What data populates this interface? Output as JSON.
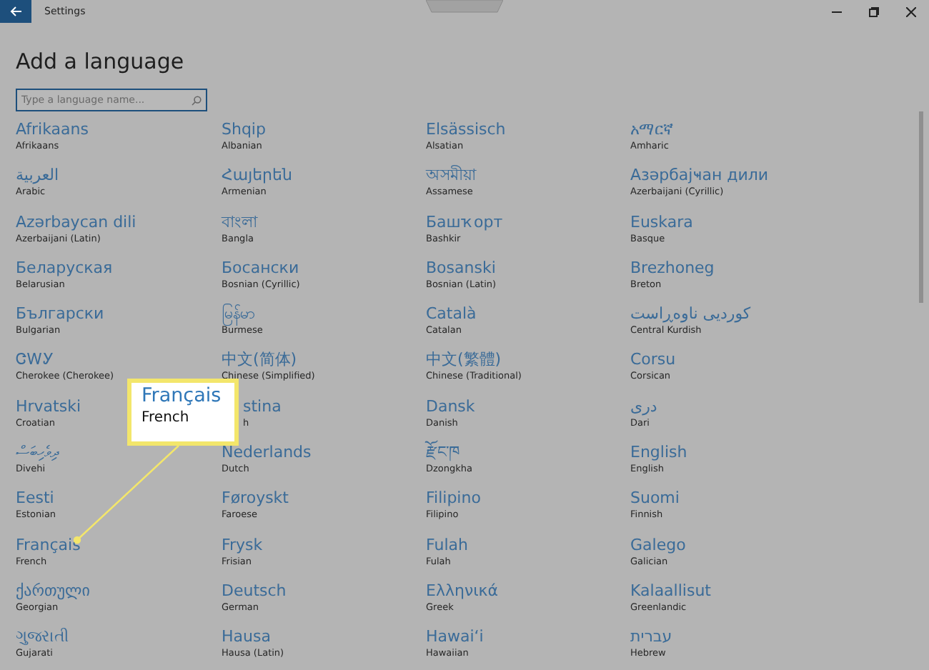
{
  "window": {
    "title": "Settings"
  },
  "heading": "Add a language",
  "search": {
    "placeholder": "Type a language name..."
  },
  "languages": [
    {
      "kind": "plain",
      "native": "Afrikaans",
      "english": "Afrikaans"
    },
    {
      "kind": "plain",
      "native": "Shqip",
      "english": "Albanian"
    },
    {
      "kind": "plain",
      "native": "Elsässisch",
      "english": "Alsatian"
    },
    {
      "kind": "plain",
      "native": "አማርኛ",
      "english": "Amharic"
    },
    {
      "kind": "plain",
      "native": "العربية",
      "english": "Arabic"
    },
    {
      "kind": "plain",
      "native": "Հայերեն",
      "english": "Armenian"
    },
    {
      "kind": "plain",
      "native": "অসমীয়া",
      "english": "Assamese"
    },
    {
      "kind": "plain",
      "native": "Азәрбајҹан дили",
      "english": "Azerbaijani (Cyrillic)"
    },
    {
      "kind": "plain",
      "native": "Azərbaycan dili",
      "english": "Azerbaijani (Latin)"
    },
    {
      "kind": "plain",
      "native": "বাংলা",
      "english": "Bangla"
    },
    {
      "kind": "plain",
      "native": "Башҡорт",
      "english": "Bashkir"
    },
    {
      "kind": "plain",
      "native": "Euskara",
      "english": "Basque"
    },
    {
      "kind": "plain",
      "native": "Беларуская",
      "english": "Belarusian"
    },
    {
      "kind": "plain",
      "native": "Босански",
      "english": "Bosnian (Cyrillic)"
    },
    {
      "kind": "plain",
      "native": "Bosanski",
      "english": "Bosnian (Latin)"
    },
    {
      "kind": "plain",
      "native": "Brezhoneg",
      "english": "Breton"
    },
    {
      "kind": "plain",
      "native": "Български",
      "english": "Bulgarian"
    },
    {
      "kind": "plain",
      "native": "မြန်မာ",
      "english": "Burmese"
    },
    {
      "kind": "plain",
      "native": "Català",
      "english": "Catalan"
    },
    {
      "kind": "plain",
      "native": "کوردیی ناوەڕاست",
      "english": "Central Kurdish"
    },
    {
      "kind": "plain",
      "native": "ᏣᎳᎩ",
      "english": "Cherokee (Cherokee)"
    },
    {
      "kind": "plain",
      "native": "中文(简体)",
      "english": "Chinese (Simplified)"
    },
    {
      "kind": "plain",
      "native": "中文(繁體)",
      "english": "Chinese (Traditional)"
    },
    {
      "kind": "plain",
      "native": "Corsu",
      "english": "Corsican"
    },
    {
      "kind": "plain",
      "native": "Hrvatski",
      "english": "Croatian"
    },
    {
      "kind": "covered",
      "native": "stina",
      "english": "h"
    },
    {
      "kind": "plain",
      "native": "Dansk",
      "english": "Danish"
    },
    {
      "kind": "plain",
      "native": "دری",
      "english": "Dari"
    },
    {
      "kind": "plain",
      "native": "ދިވެހިބަސް",
      "english": "Divehi"
    },
    {
      "kind": "plain",
      "native": "Nederlands",
      "english": "Dutch"
    },
    {
      "kind": "plain",
      "native": "རྫོང་ཁ",
      "english": "Dzongkha"
    },
    {
      "kind": "plain",
      "native": "English",
      "english": "English"
    },
    {
      "kind": "plain",
      "native": "Eesti",
      "english": "Estonian"
    },
    {
      "kind": "plain",
      "native": "Føroyskt",
      "english": "Faroese"
    },
    {
      "kind": "plain",
      "native": "Filipino",
      "english": "Filipino"
    },
    {
      "kind": "plain",
      "native": "Suomi",
      "english": "Finnish"
    },
    {
      "kind": "plain",
      "native": "Français",
      "english": "French"
    },
    {
      "kind": "plain",
      "native": "Frysk",
      "english": "Frisian"
    },
    {
      "kind": "plain",
      "native": "Fulah",
      "english": "Fulah"
    },
    {
      "kind": "plain",
      "native": "Galego",
      "english": "Galician"
    },
    {
      "kind": "plain",
      "native": "ქართული",
      "english": "Georgian"
    },
    {
      "kind": "plain",
      "native": "Deutsch",
      "english": "German"
    },
    {
      "kind": "plain",
      "native": "Ελληνικά",
      "english": "Greek"
    },
    {
      "kind": "plain",
      "native": "Kalaallisut",
      "english": "Greenlandic"
    },
    {
      "kind": "plain",
      "native": "ગુજરાતી",
      "english": "Gujarati"
    },
    {
      "kind": "plain",
      "native": "Hausa",
      "english": "Hausa (Latin)"
    },
    {
      "kind": "plain",
      "native": "Hawaiʻi",
      "english": "Hawaiian"
    },
    {
      "kind": "plain",
      "native": "עברית",
      "english": "Hebrew"
    }
  ],
  "callout": {
    "native": "Français",
    "english": "French"
  }
}
